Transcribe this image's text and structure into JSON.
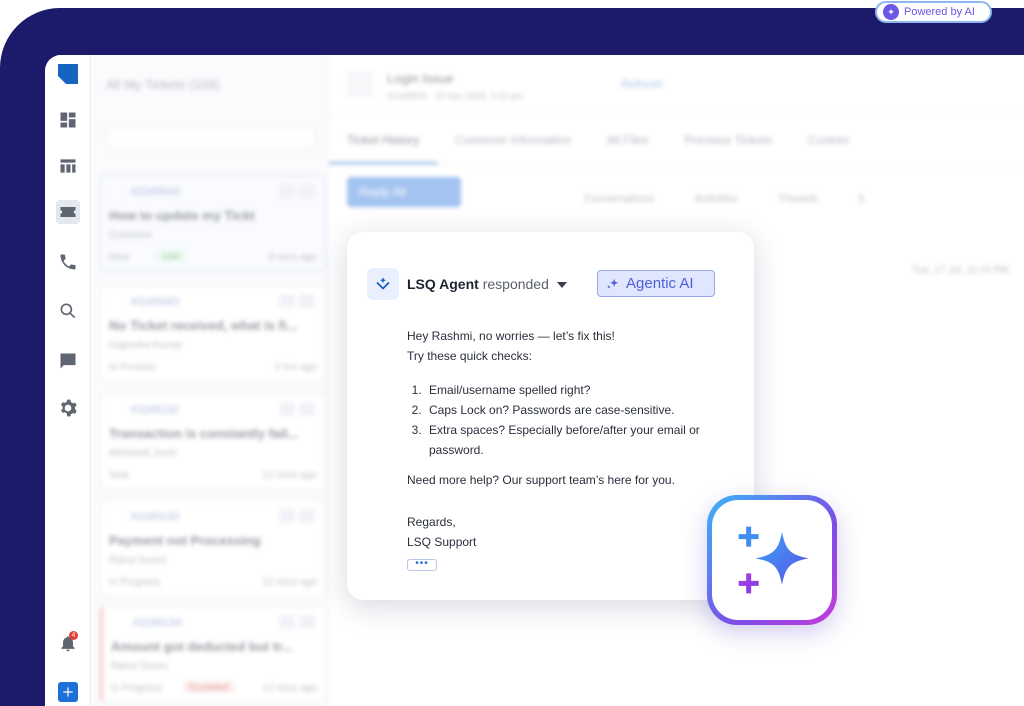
{
  "powered_badge": {
    "label": "Powered by AI",
    "icon": "ai-sparkle-icon"
  },
  "rail": {
    "icons": [
      "logo",
      "dashboard-icon",
      "table-icon",
      "ticket-icon",
      "phone-icon",
      "search-icon",
      "chat-icon",
      "gear-icon",
      "bell-icon",
      "plus-icon"
    ],
    "notification_count": "4"
  },
  "background": {
    "list_header": "All My Tickets (109)",
    "tickets": [
      {
        "id": "#2345543",
        "title": "How to update my Tickt",
        "name": "Customer",
        "status": "New",
        "tag": "Low",
        "time": "8 secs ago"
      },
      {
        "id": "#1165043",
        "title": "No Ticket received, what is fi...",
        "name": "Gajendra Kumar",
        "status": "In Process",
        "time": "2 hrs ago"
      },
      {
        "id": "#1165132",
        "title": "Transaction is constantly fail...",
        "name": "Abhishek Joshi",
        "status": "New",
        "time": "12 mins ago"
      },
      {
        "id": "#1165133",
        "title": "Payment not Processing",
        "name": "Rahul Sunes",
        "status": "In Progress",
        "time": "12 mins ago"
      },
      {
        "id": "#1165134",
        "title": "Amount got deducted but tr...",
        "name": "Rahul Sunes",
        "status": "In Progress",
        "tag": "Escalated",
        "time": "12 mins ago"
      }
    ],
    "ticket_title": "Login Issue",
    "ticket_meta": "#1168923 · 15 Nov 2023, 3:22 pm",
    "refresh_label": "Refresh",
    "tabs": [
      "Ticket History",
      "Customer Information",
      "All Files",
      "Previous Tickets",
      "Custom"
    ],
    "reply_label": "Reply All",
    "subtabs": [
      "Conversations",
      "Activities",
      "Threads"
    ],
    "threads_count": "5",
    "date": "Tue, 17 Jul, 11:15 PM"
  },
  "response_card": {
    "agent_name": "LSQ Agent",
    "agent_action": "responded",
    "agentic_label": "Agentic AI",
    "greeting": "Hey Rashmi, no worries — let’s fix this!",
    "intro": "Try these quick checks:",
    "checks": [
      "Email/username spelled right?",
      "Caps Lock on? Passwords are case-sensitive.",
      "Extra spaces? Especially before/after your email or password."
    ],
    "help": "Need more help? Our support team’s here for you.",
    "sign_off": "Regards,",
    "signature": "LSQ Support",
    "more_label": "•••"
  },
  "colors": {
    "navy": "#1b1a6b",
    "accent": "#1e6fd9",
    "agentic": "#4f5fd6"
  }
}
